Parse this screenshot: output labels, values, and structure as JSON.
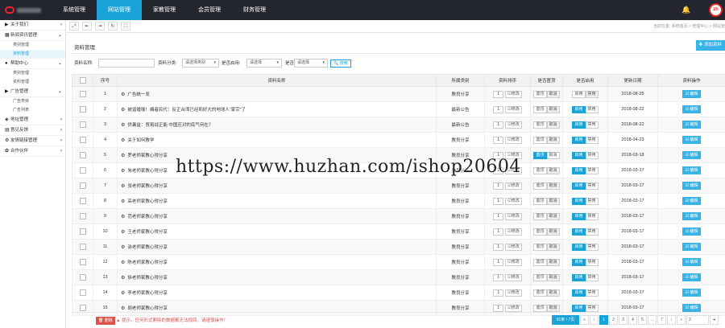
{
  "nav": {
    "items": [
      "系统管理",
      "网站管理",
      "家教管理",
      "会员管理",
      "财务管理"
    ],
    "active_index": 1
  },
  "header": {
    "avatar_text": "zh",
    "bell_icon": "bell-icon"
  },
  "sidebar": {
    "groups": [
      {
        "icon": "▶",
        "label": "关于我们",
        "chevron": "›"
      },
      {
        "icon": "▦",
        "label": "新闻资讯管理",
        "chevron": "⌄",
        "items": [
          "类别管理",
          "资料管理"
        ],
        "selected": 1
      },
      {
        "icon": "●",
        "label": "帮助中心",
        "chevron": "⌄",
        "items": [
          "类别管理",
          "资料管理"
        ]
      },
      {
        "icon": "▶",
        "label": "广告管理",
        "chevron": "⌄",
        "items": [
          "广告类目",
          "广告列表"
        ]
      },
      {
        "icon": "◈",
        "label": "地址管理",
        "chevron": "›"
      },
      {
        "icon": "▤",
        "label": "意见反馈",
        "chevron": "›"
      },
      {
        "icon": "⚙",
        "label": "友情链接管理",
        "chevron": "›"
      },
      {
        "icon": "✿",
        "label": "合作伙伴",
        "chevron": "›"
      }
    ]
  },
  "toolbar": {
    "expand": "⤢",
    "prev": "⇤",
    "next": "⇥",
    "refresh": "↻",
    "fullscreen": "⛶",
    "breadcrumb": "当前位置: 系统首页 > 管理中心 > 网站管"
  },
  "page": {
    "title": "资料管理",
    "add_label": "✚ 添加资料"
  },
  "filters": {
    "name_label": "资料名称:",
    "category_label": "资料分类:",
    "category_value": "请选择类别",
    "pos_label": "是否启用:",
    "pos_value": "请选择",
    "show_label": "是否置顶:",
    "show_value": "请选择",
    "search_label": "🔍 搜索"
  },
  "table": {
    "headers": [
      "",
      "序号",
      "资料名称",
      "所属类别",
      "资料排序",
      "是否置顶",
      "是否启用",
      "更新日期",
      "资料操作"
    ],
    "modify_label": "☑修改",
    "top_label": "置顶",
    "cancel_label": "取消",
    "enable_label": "启用",
    "disable_label": "禁用",
    "edit_label": "☑ 编辑",
    "rows": [
      {
        "no": "1",
        "name": "广告统一发",
        "cat": "教员分享",
        "sort": "1",
        "top": false,
        "enable": false,
        "date": "2018-08-25"
      },
      {
        "no": "2",
        "name": "被逼婚咖！编者民代：反正台湾已经和好大的地球人“家宗”了",
        "cat": "最新公告",
        "sort": "1",
        "top": false,
        "enable": true,
        "date": "2018-08-22"
      },
      {
        "no": "3",
        "name": "供暑益：贸易战正能 中国应对的底气何在？",
        "cat": "最新公告",
        "sort": "1",
        "top": false,
        "enable": true,
        "date": "2018-08-22"
      },
      {
        "no": "4",
        "name": "关于如何教学",
        "cat": "教员分享",
        "sort": "1",
        "top": false,
        "enable": true,
        "date": "2018-04-23"
      },
      {
        "no": "5",
        "name": "罗老师家教心得分享",
        "cat": "教员分享",
        "sort": "1",
        "top": true,
        "enable": true,
        "date": "2018-03-18"
      },
      {
        "no": "6",
        "name": "朱老师家教心得分享",
        "cat": "教员分享",
        "sort": "1",
        "top": false,
        "enable": true,
        "date": "2018-03-17"
      },
      {
        "no": "7",
        "name": "张老师家教心得分享",
        "cat": "教员分享",
        "sort": "1",
        "top": false,
        "enable": true,
        "date": "2018-03-17"
      },
      {
        "no": "8",
        "name": "高老师家教心得分享",
        "cat": "教员分享",
        "sort": "1",
        "top": false,
        "enable": true,
        "date": "2018-03-17"
      },
      {
        "no": "9",
        "name": "范老师家教心得分享",
        "cat": "教员分享",
        "sort": "1",
        "top": false,
        "enable": true,
        "date": "2018-03-17"
      },
      {
        "no": "10",
        "name": "王老师家教心得分享",
        "cat": "教员分享",
        "sort": "1",
        "top": false,
        "enable": true,
        "date": "2018-03-17"
      },
      {
        "no": "11",
        "name": "涂老师家教心得分享",
        "cat": "教员分享",
        "sort": "1",
        "top": false,
        "enable": true,
        "date": "2018-03-17"
      },
      {
        "no": "12",
        "name": "陈老师家教心得分享",
        "cat": "教员分享",
        "sort": "1",
        "top": false,
        "enable": true,
        "date": "2018-03-17"
      },
      {
        "no": "13",
        "name": "徐老师家教心得分享",
        "cat": "教员分享",
        "sort": "1",
        "top": false,
        "enable": true,
        "date": "2018-03-17"
      },
      {
        "no": "14",
        "name": "李老师家教心得分享",
        "cat": "教员分享",
        "sort": "1",
        "top": false,
        "enable": true,
        "date": "2018-03-17"
      },
      {
        "no": "15",
        "name": "胡老师家教心得分享",
        "cat": "教员分享",
        "sort": "1",
        "top": false,
        "enable": true,
        "date": "2018-03-17"
      }
    ]
  },
  "footer": {
    "delete_label": "删除",
    "hint": "提示，任何形式删除的数据都无法找回，请谨慎操作！",
    "total": "91条 / 7页",
    "pages": [
      "«",
      "‹",
      "1",
      "2",
      "3",
      "4",
      "5",
      "…",
      "7",
      "›",
      "»"
    ],
    "current": "1",
    "jump": "2",
    "go": "➜"
  },
  "watermark": "https://www.huzhan.com/ishop20604",
  "colors": {
    "accent": "#1aa3d6",
    "topbar": "#23262e",
    "danger": "#d9534f"
  }
}
